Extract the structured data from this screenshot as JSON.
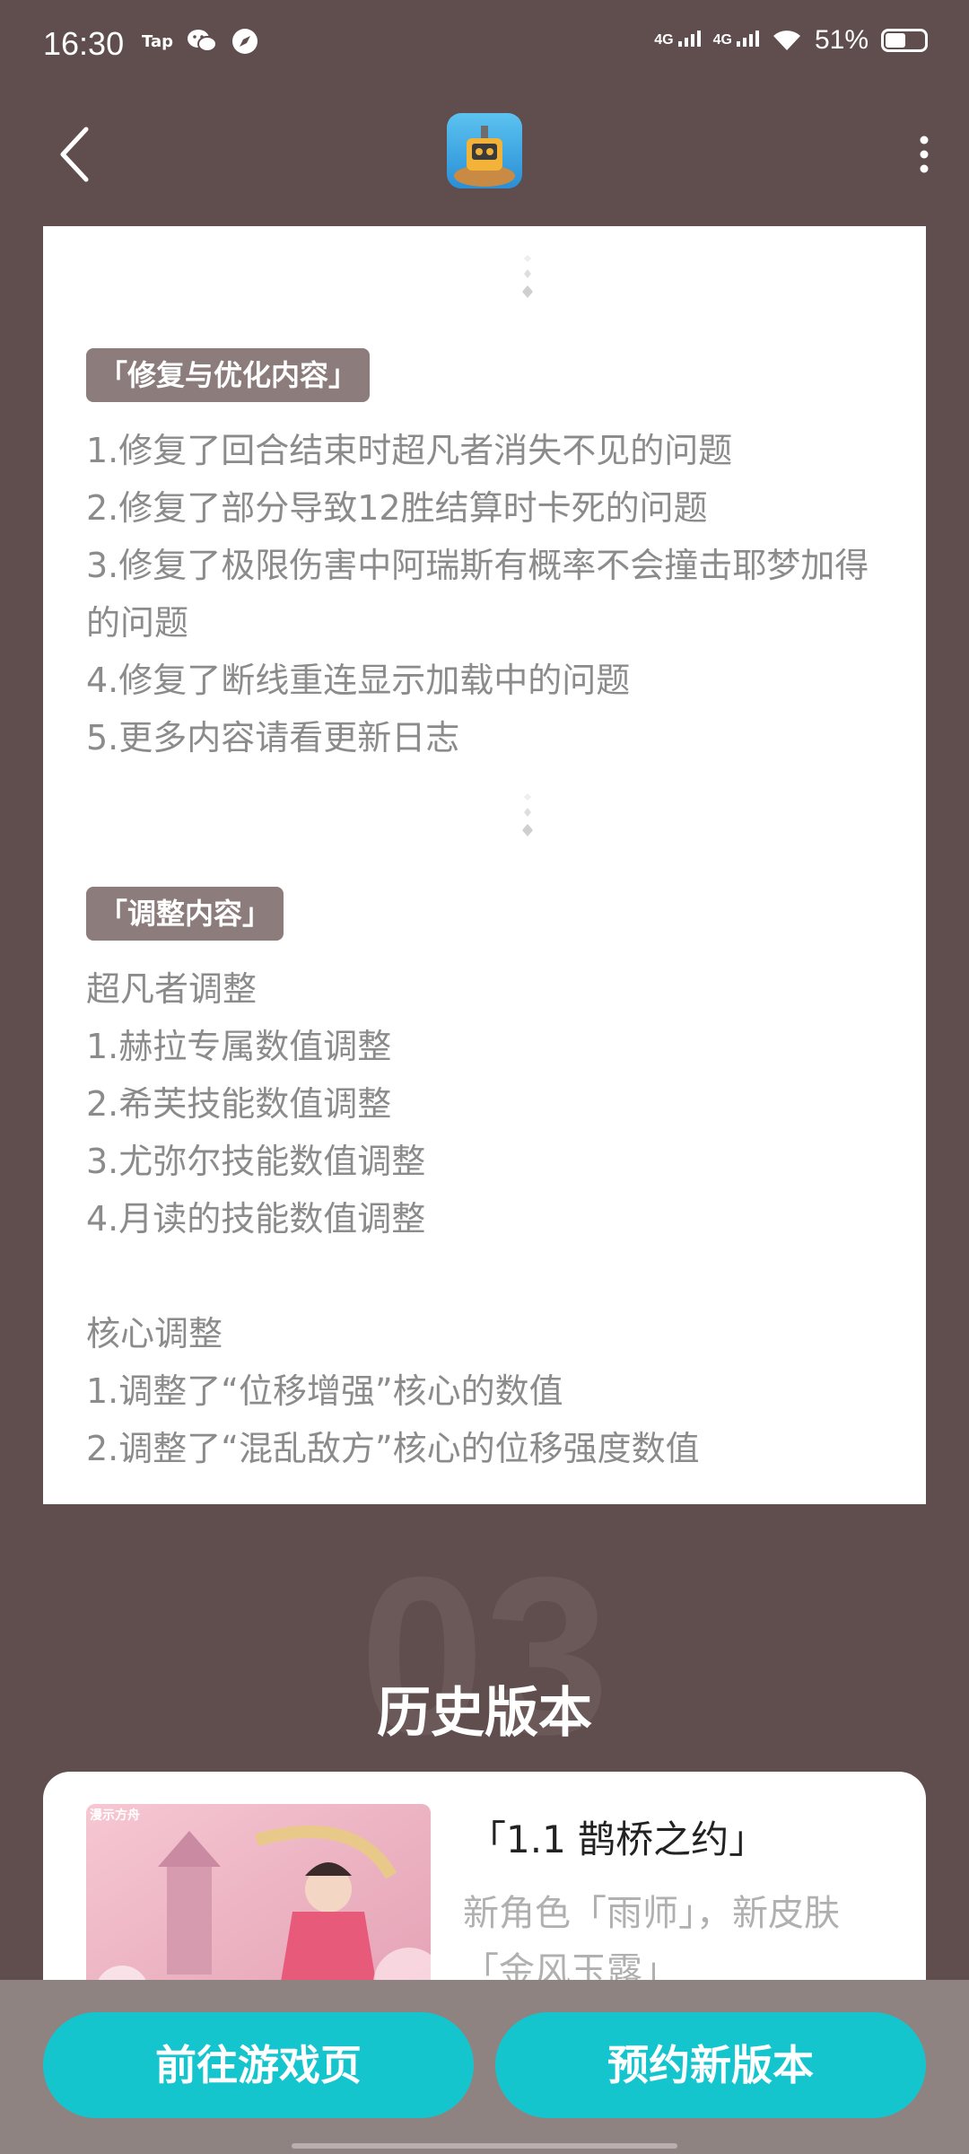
{
  "status_bar": {
    "time": "16:30",
    "left_mini_label": "Tap",
    "signal_1": "4G",
    "signal_2": "4G",
    "battery_text": "51%",
    "battery_level": 0.51,
    "icons": [
      "taptap-icon",
      "wechat-icon",
      "compass-icon",
      "signal-icon",
      "wifi-icon",
      "battery-icon"
    ]
  },
  "header": {
    "icons": [
      "back-arrow-icon",
      "app-icon",
      "more-vertical-icon"
    ]
  },
  "section_fix": {
    "tag": "「修复与优化内容」",
    "items": [
      "1.修复了回合结束时超凡者消失不见的问题",
      "2.修复了部分导致12胜结算时卡死的问题",
      "3.修复了极限伤害中阿瑞斯有概率不会撞击耶梦加得的问题",
      "4.修复了断线重连显示加载中的问题",
      "5.更多内容请看更新日志"
    ]
  },
  "section_adjust": {
    "tag": "「调整内容」",
    "items": [
      "超凡者调整",
      "1.赫拉专属数值调整",
      "2.希芙技能数值调整",
      "3.尤弥尔技能数值调整",
      "4.月读的技能数值调整",
      "",
      "核心调整",
      "1.调整了“位移增强”核心的数值",
      "2.调整了“混乱敌方”核心的位移强度数值"
    ]
  },
  "history": {
    "bg_number": "03",
    "title": "历史版本",
    "version": "「1.1 鹊桥之约」",
    "description": "新角色「雨师」，新皮肤「金风玉露」",
    "image_logo": "漫示方舟"
  },
  "bottom_bar": {
    "left_button": "前往游戏页",
    "right_button": "预约新版本"
  },
  "colors": {
    "background": "#5f4e4d",
    "tag_bg": "#8c7c7b",
    "accent": "#15c5ce",
    "bottom_bar": "#8f8382"
  }
}
